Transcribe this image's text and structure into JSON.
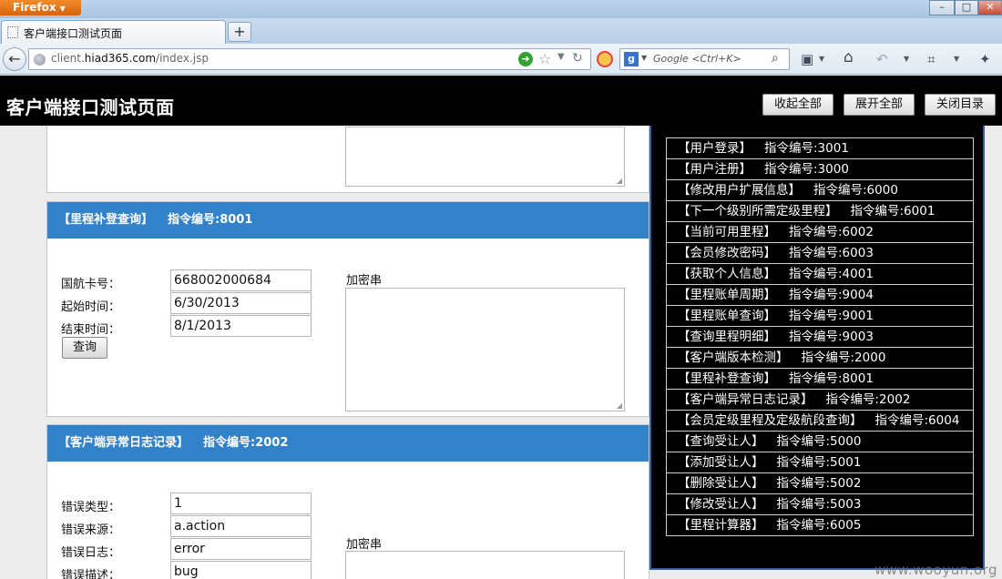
{
  "browser": {
    "menu_label": "Firefox",
    "tab_title": "客户端接口测试页面",
    "url_prefix": "client.",
    "url_domain": "hiad365.com",
    "url_path": "/index.jsp",
    "search_placeholder": "Google <Ctrl+K>"
  },
  "header": {
    "title": "客户端接口测试页面",
    "collapse_all": "收起全部",
    "expand_all": "展开全部",
    "close_dir": "关闭目录"
  },
  "sections": {
    "mileage": {
      "title": "【里程补登查询】",
      "cmd": "指令编号:8001",
      "fields": [
        {
          "label": "国航卡号：",
          "value": "668002000684"
        },
        {
          "label": "起始时间：",
          "value": "6/30/2013"
        },
        {
          "label": "结束时间：",
          "value": "8/1/2013"
        }
      ],
      "enc_label": "加密串",
      "query": "查询"
    },
    "errlog": {
      "title": "【客户端异常日志记录】",
      "cmd": "指令编号:2002",
      "fields": [
        {
          "label": "错误类型：",
          "value": "1"
        },
        {
          "label": "错误来源：",
          "value": "a.action"
        },
        {
          "label": "错误日志：",
          "value": "error"
        },
        {
          "label": "错误描述：",
          "value": "bug"
        }
      ],
      "enc_label": "加密串"
    }
  },
  "directory": [
    {
      "name": "【用户登录】",
      "cmd": "指令编号:3001"
    },
    {
      "name": "【用户注册】",
      "cmd": "指令编号:3000"
    },
    {
      "name": "【修改用户扩展信息】",
      "cmd": "指令编号:6000"
    },
    {
      "name": "【下一个级别所需定级里程】",
      "cmd": "指令编号:6001"
    },
    {
      "name": "【当前可用里程】",
      "cmd": "指令编号:6002"
    },
    {
      "name": "【会员修改密码】",
      "cmd": "指令编号:6003"
    },
    {
      "name": "【获取个人信息】",
      "cmd": "指令编号:4001"
    },
    {
      "name": "【里程账单周期】",
      "cmd": "指令编号:9004"
    },
    {
      "name": "【里程账单查询】",
      "cmd": "指令编号:9001"
    },
    {
      "name": "【查询里程明细】",
      "cmd": "指令编号:9003"
    },
    {
      "name": "【客户端版本检测】",
      "cmd": "指令编号:2000"
    },
    {
      "name": "【里程补登查询】",
      "cmd": "指令编号:8001"
    },
    {
      "name": "【客户端异常日志记录】",
      "cmd": "指令编号:2002"
    },
    {
      "name": "【会员定级里程及定级航段查询】",
      "cmd": "指令编号:6004"
    },
    {
      "name": "【查询受让人】",
      "cmd": "指令编号:5000"
    },
    {
      "name": "【添加受让人】",
      "cmd": "指令编号:5001"
    },
    {
      "name": "【删除受让人】",
      "cmd": "指令编号:5002"
    },
    {
      "name": "【修改受让人】",
      "cmd": "指令编号:5003"
    },
    {
      "name": "【里程计算器】",
      "cmd": "指令编号:6005"
    }
  ],
  "watermark": "www.wooyun.org"
}
